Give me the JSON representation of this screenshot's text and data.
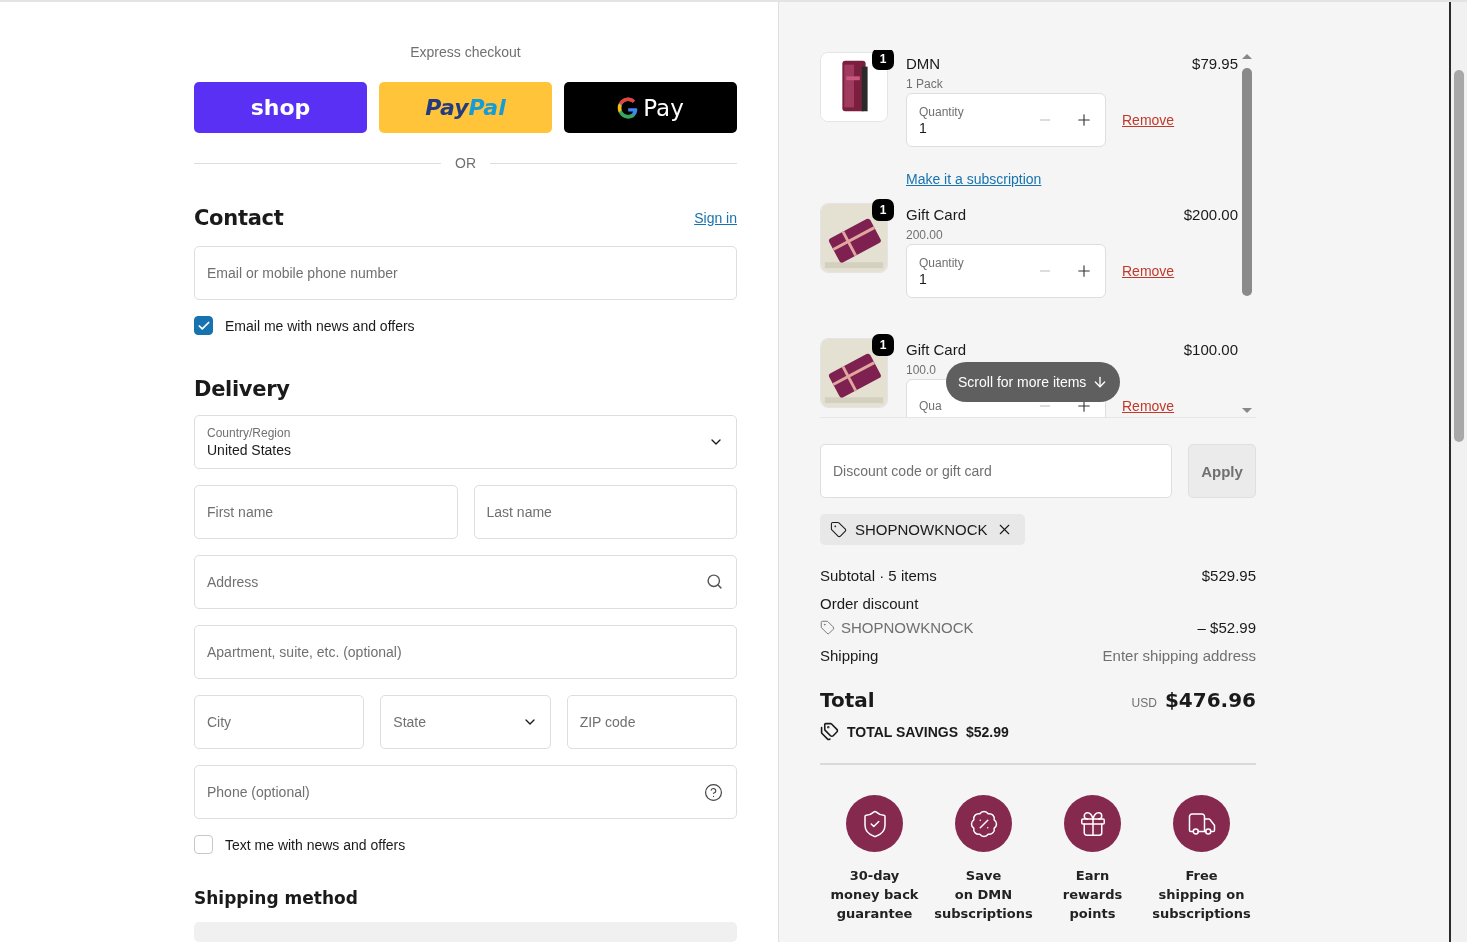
{
  "express_checkout": {
    "title": "Express checkout",
    "buttons": [
      {
        "kind": "shop",
        "label": "shop"
      },
      {
        "kind": "paypal",
        "label_parts": [
          "Pay",
          "Pal"
        ]
      },
      {
        "kind": "gpay",
        "label": "Pay"
      }
    ]
  },
  "or_label": "OR",
  "contact": {
    "heading": "Contact",
    "sign_in": "Sign in",
    "email": {
      "placeholder": "Email or mobile phone number"
    },
    "news_checkbox": {
      "label": "Email me with news and offers",
      "checked": true
    }
  },
  "delivery": {
    "heading": "Delivery",
    "country": {
      "label": "Country/Region",
      "value": "United States"
    },
    "first_name": {
      "placeholder": "First name"
    },
    "last_name": {
      "placeholder": "Last name"
    },
    "address": {
      "placeholder": "Address"
    },
    "apartment": {
      "placeholder": "Apartment, suite, etc. (optional)"
    },
    "city": {
      "placeholder": "City"
    },
    "state": {
      "placeholder": "State"
    },
    "zip": {
      "placeholder": "ZIP code"
    },
    "phone": {
      "placeholder": "Phone (optional)"
    },
    "text_checkbox": {
      "label": "Text me with news and offers",
      "checked": false
    }
  },
  "shipping_method": {
    "heading": "Shipping method"
  },
  "cart": {
    "items": [
      {
        "kind": "bag",
        "badge": "1",
        "name": "DMN",
        "variant": "1 Pack",
        "price": "$79.95",
        "quantity_label": "Quantity",
        "quantity": "1",
        "remove": "Remove",
        "subscription_link": "Make it a subscription"
      },
      {
        "kind": "card",
        "badge": "1",
        "name": "Gift Card",
        "variant": "200.00",
        "price": "$200.00",
        "quantity_label": "Quantity",
        "quantity": "1",
        "remove": "Remove"
      },
      {
        "kind": "card",
        "badge": "1",
        "name": "Gift Card",
        "variant": "100.0",
        "price": "$100.00",
        "quantity_label": "Qua",
        "remove": "Remove"
      }
    ],
    "scroll_hint": "Scroll for more items"
  },
  "discount": {
    "placeholder": "Discount code or gift card",
    "apply": "Apply",
    "applied_code": "SHOPNOWKNOCK"
  },
  "summary": {
    "subtotal_label": "Subtotal · 5 items",
    "subtotal": "$529.95",
    "discount_label": "Order discount",
    "discount_code": "SHOPNOWKNOCK",
    "discount_amount": "– $52.99",
    "shipping_label": "Shipping",
    "shipping_value": "Enter shipping address",
    "total_label": "Total",
    "currency": "USD",
    "total": "$476.96",
    "savings_label": "TOTAL SAVINGS",
    "savings": "$52.99"
  },
  "perks": [
    {
      "kind": "shield",
      "lines": [
        "30-day",
        "money back",
        "guarantee"
      ]
    },
    {
      "kind": "percent",
      "lines": [
        "Save",
        "on DMN",
        "subscriptions"
      ]
    },
    {
      "kind": "gift",
      "lines": [
        "Earn",
        "rewards",
        "points"
      ]
    },
    {
      "kind": "truck",
      "lines": [
        "Free",
        "shipping on",
        "subscriptions"
      ]
    }
  ]
}
